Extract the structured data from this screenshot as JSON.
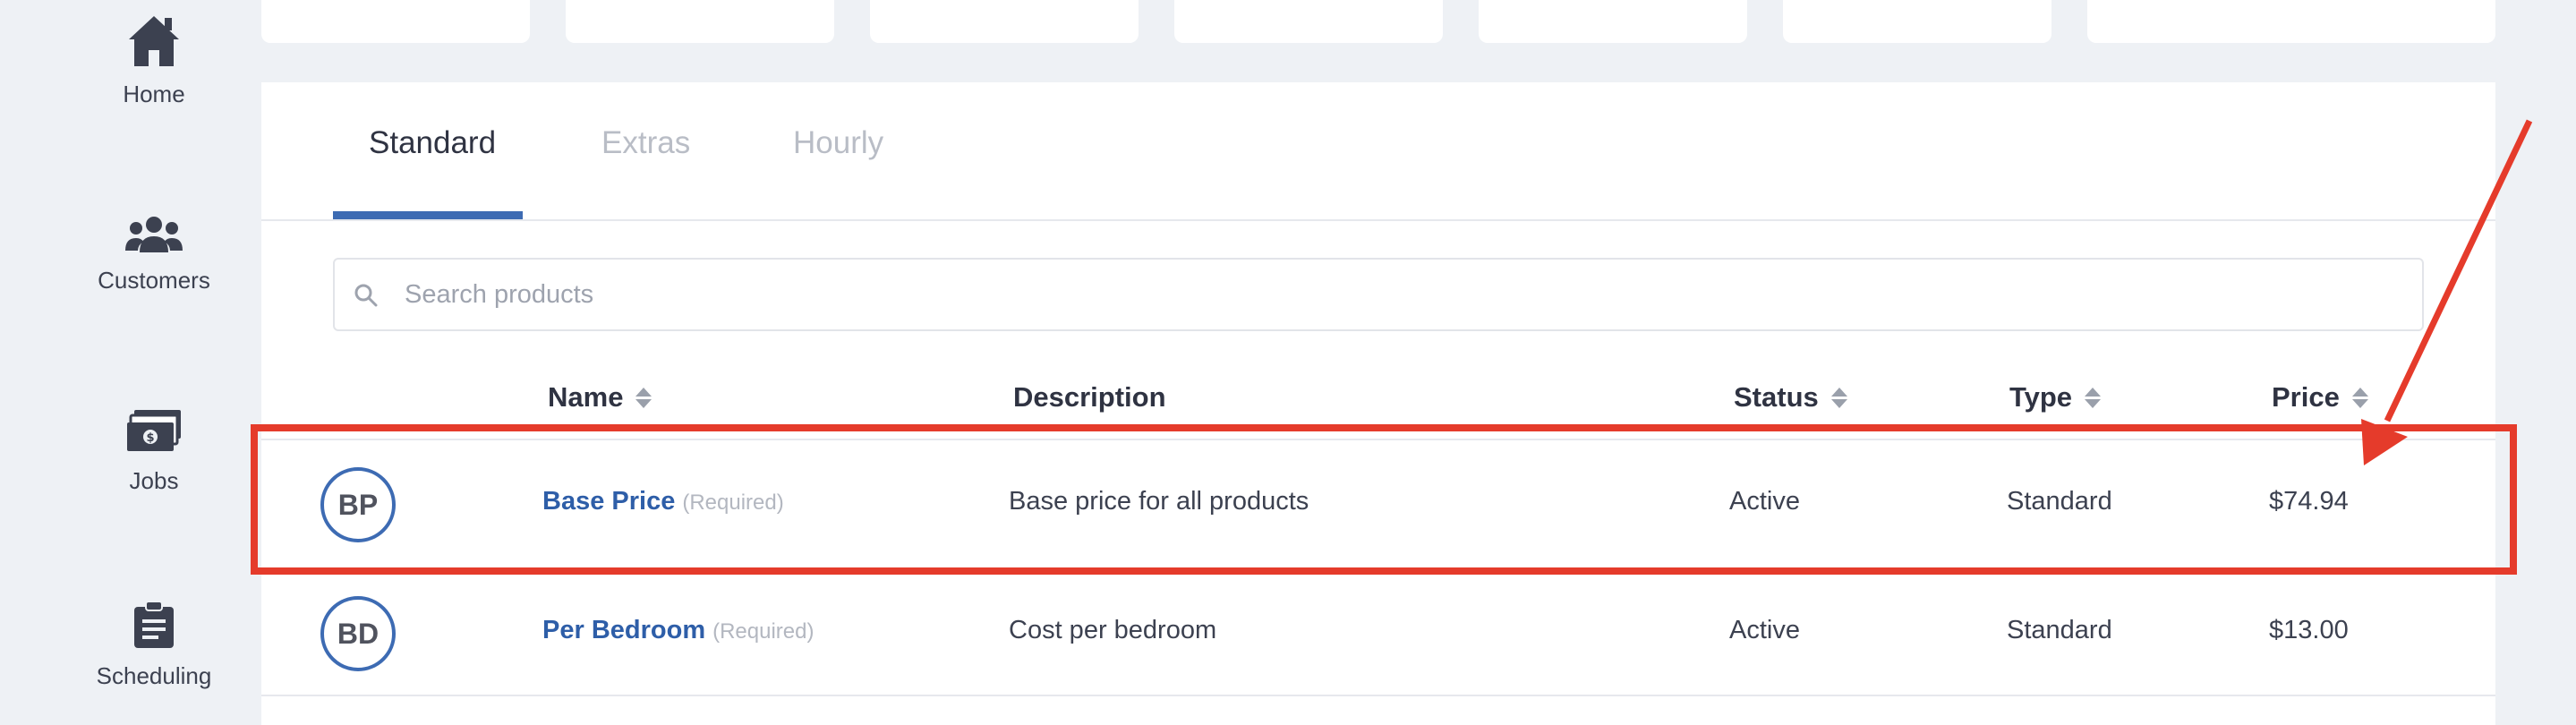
{
  "sidebar": {
    "items": [
      {
        "label": "Home",
        "icon": "home-icon"
      },
      {
        "label": "Customers",
        "icon": "users-icon"
      },
      {
        "label": "Jobs",
        "icon": "money-icon"
      },
      {
        "label": "Scheduling",
        "icon": "clipboard-icon"
      }
    ]
  },
  "tabs": [
    {
      "label": "Standard",
      "active": true
    },
    {
      "label": "Extras",
      "active": false
    },
    {
      "label": "Hourly",
      "active": false
    }
  ],
  "search": {
    "placeholder": "Search products",
    "value": ""
  },
  "table": {
    "columns": {
      "name": "Name",
      "description": "Description",
      "status": "Status",
      "type": "Type",
      "price": "Price"
    },
    "rows": [
      {
        "initials": "BP",
        "name": "Base Price",
        "required": "(Required)",
        "description": "Base price for all products",
        "status": "Active",
        "type": "Standard",
        "price": "$74.94"
      },
      {
        "initials": "BD",
        "name": "Per Bedroom",
        "required": "(Required)",
        "description": "Cost per bedroom",
        "status": "Active",
        "type": "Standard",
        "price": "$13.00"
      }
    ]
  },
  "colors": {
    "accent": "#3d6bb3",
    "link": "#2e5ea8",
    "annotation": "#e53b2b",
    "background": "#eef1f5"
  }
}
